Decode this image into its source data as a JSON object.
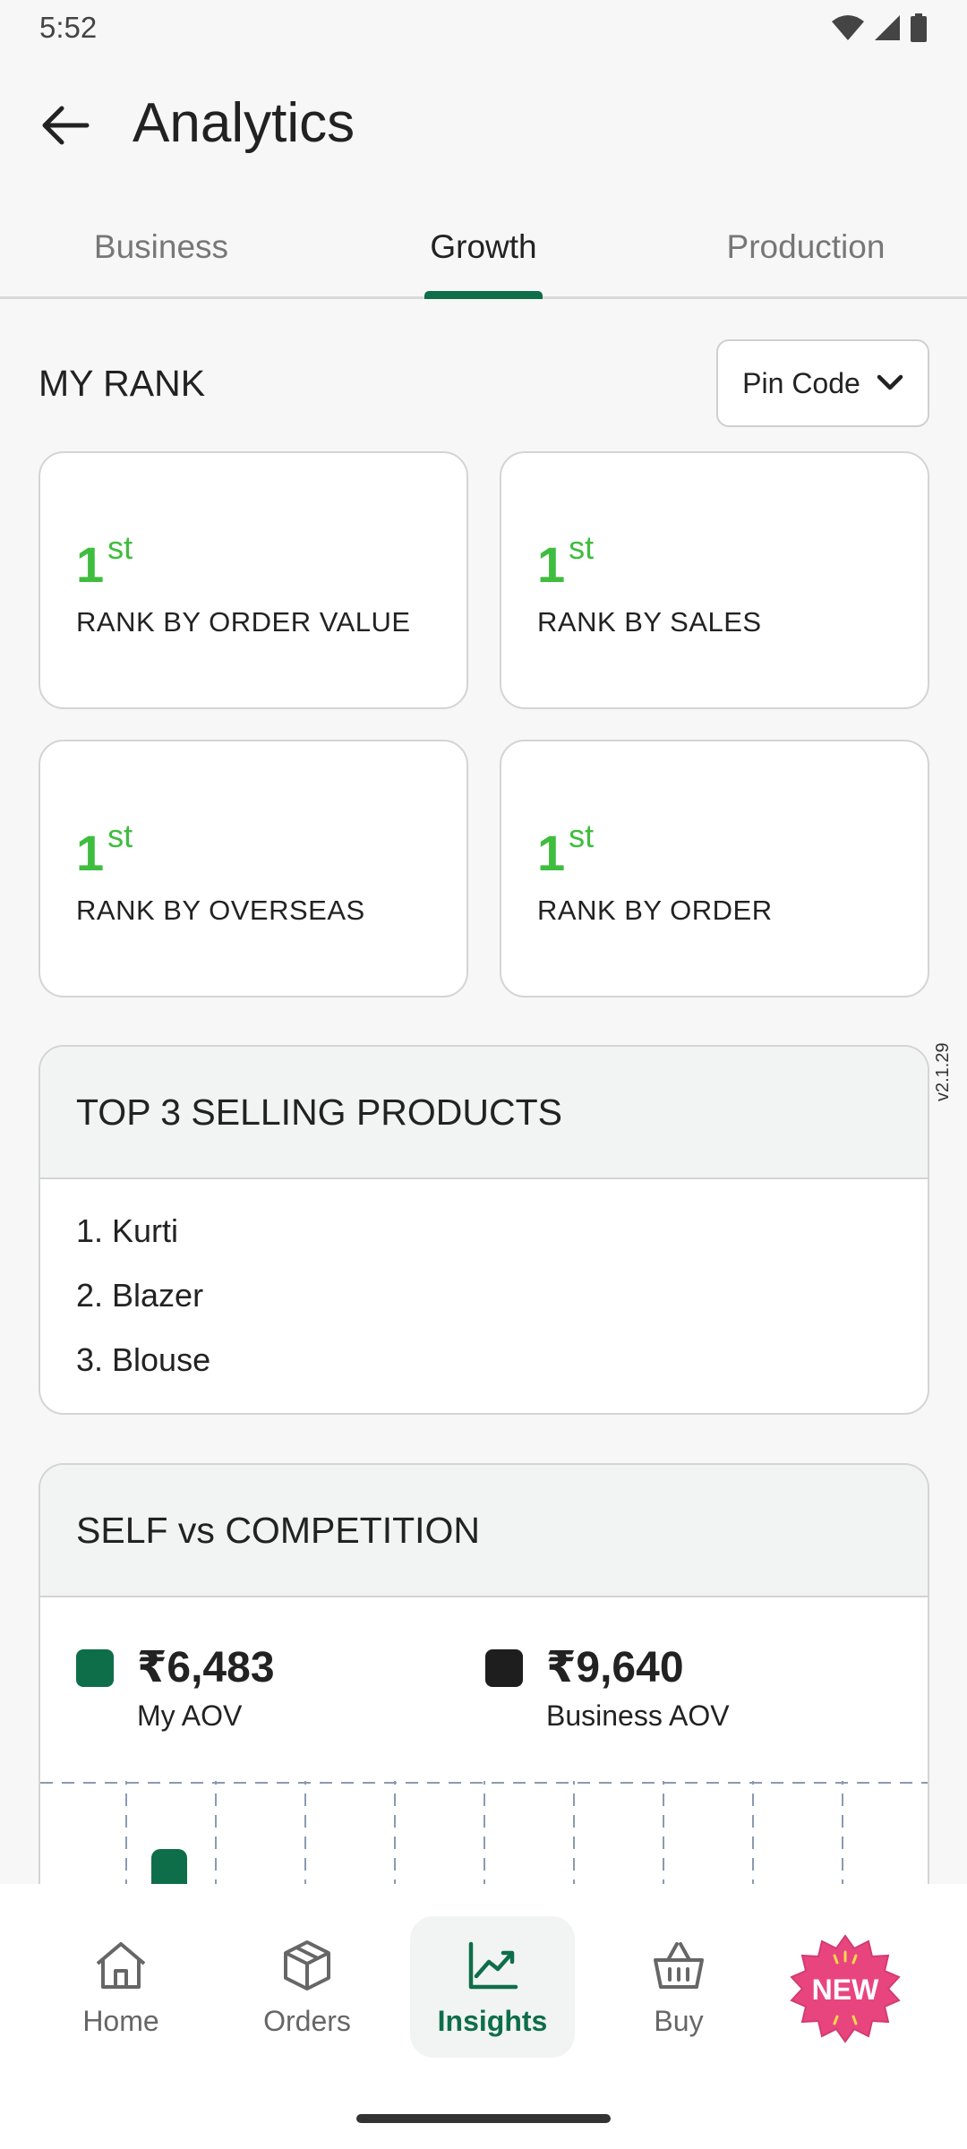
{
  "status_bar": {
    "time": "5:52"
  },
  "app_bar": {
    "title": "Analytics"
  },
  "tabs": [
    {
      "label": "Business",
      "active": false
    },
    {
      "label": "Growth",
      "active": true
    },
    {
      "label": "Production",
      "active": false
    }
  ],
  "my_rank": {
    "title": "MY RANK",
    "filter": {
      "selected": "Pin Code"
    },
    "cards": [
      {
        "rank": "1",
        "suffix": "st",
        "label": "RANK BY ORDER VALUE"
      },
      {
        "rank": "1",
        "suffix": "st",
        "label": "RANK BY SALES"
      },
      {
        "rank": "1",
        "suffix": "st",
        "label": "RANK BY OVERSEAS"
      },
      {
        "rank": "1",
        "suffix": "st",
        "label": "RANK BY ORDER"
      }
    ]
  },
  "version": "v2.1.29",
  "top_products": {
    "title": "TOP 3 SELLING PRODUCTS",
    "items": [
      "1. Kurti",
      "2. Blazer",
      "3. Blouse"
    ]
  },
  "self_vs_competition": {
    "title": "SELF vs COMPETITION",
    "legend": [
      {
        "value": "₹6,483",
        "label": "My AOV",
        "color": "#0f6e4a"
      },
      {
        "value": "₹9,640",
        "label": "Business AOV",
        "color": "#1e1e1e"
      }
    ]
  },
  "bottom_nav": {
    "items": [
      {
        "label": "Home",
        "icon": "home-icon",
        "active": false
      },
      {
        "label": "Orders",
        "icon": "box-icon",
        "active": false
      },
      {
        "label": "Insights",
        "icon": "chart-trend-icon",
        "active": true
      },
      {
        "label": "Buy",
        "icon": "basket-icon",
        "active": false
      }
    ],
    "badge": "NEW"
  },
  "colors": {
    "accent": "#0f6e4a",
    "rank_green": "#3fbd3f",
    "badge_pink": "#e8457f"
  }
}
